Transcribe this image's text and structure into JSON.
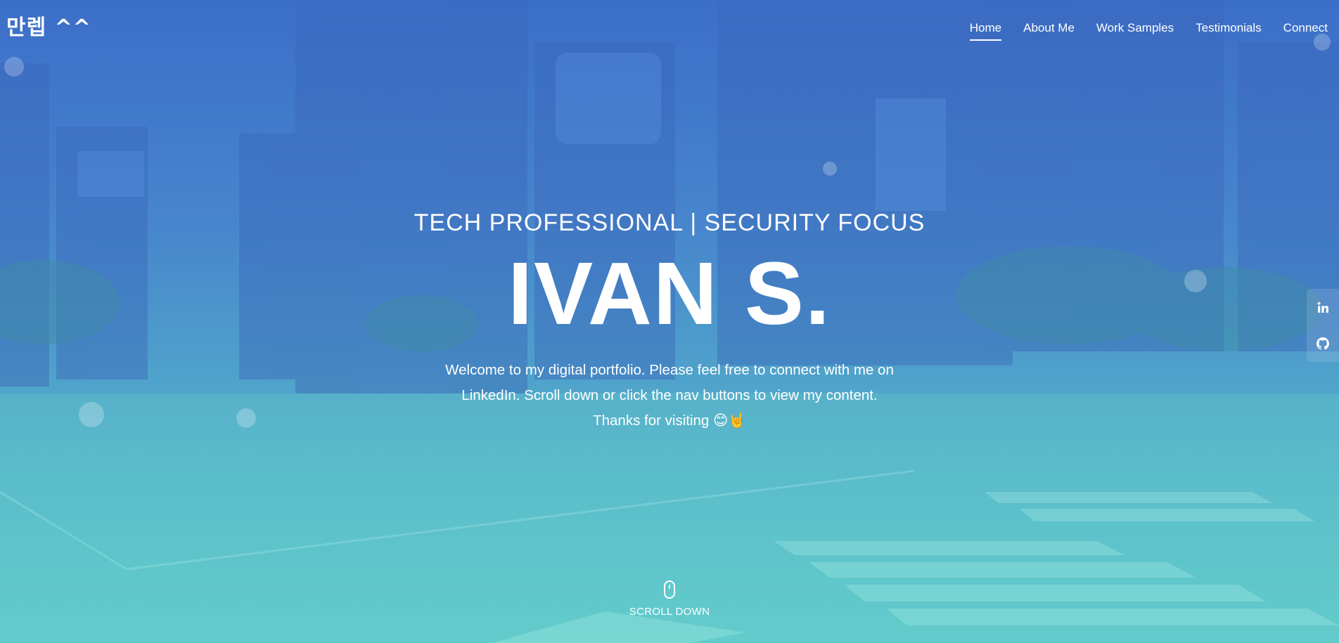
{
  "brand": "만렙 ^^",
  "nav": {
    "items": [
      {
        "label": "Home",
        "active": true
      },
      {
        "label": "About Me",
        "active": false
      },
      {
        "label": "Work Samples",
        "active": false
      },
      {
        "label": "Testimonials",
        "active": false
      },
      {
        "label": "Connect",
        "active": false
      }
    ]
  },
  "hero": {
    "subtitle": "TECH PROFESSIONAL | SECURITY FOCUS",
    "name": "IVAN S.",
    "welcome": "Welcome to my digital portfolio. Please feel free to connect with me on LinkedIn. Scroll down or click the nav buttons to view my content. Thanks for visiting 😊🤘"
  },
  "social": {
    "icons": [
      "linkedin-icon",
      "github-icon"
    ]
  },
  "scroll": {
    "label": "SCROLL DOWN",
    "icon": "mouse-icon"
  },
  "colors": {
    "top": "#3d6fc8",
    "middle": "#52a6cc",
    "bottom": "#66d0cc",
    "text": "#ffffff"
  }
}
